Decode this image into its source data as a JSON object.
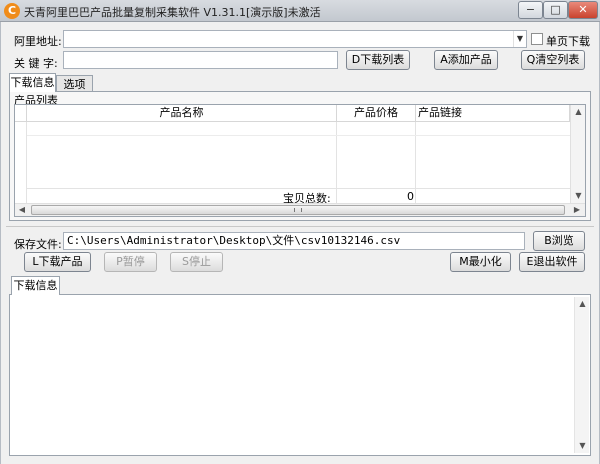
{
  "window": {
    "title": "天青阿里巴巴产品批量复制采集软件 V1.31.1[演示版]未激活",
    "app_icon_glyph": "C",
    "controls": [
      "−",
      "□",
      "✕"
    ]
  },
  "form": {
    "ali_address_label": "阿里地址:",
    "ali_address_value": "",
    "single_page_label": "单页下载",
    "single_page_checked": false,
    "keyword_label": "关 键 字:",
    "keyword_value": ""
  },
  "buttons": {
    "download_list": "D下载列表",
    "add_product": "A添加产品",
    "clear_list": "Q清空列表",
    "browse": "B浏览",
    "download_product": "L下载产品",
    "pause": "P暂停",
    "stop": "S停止",
    "minimize": "M最小化",
    "exit": "E退出软件"
  },
  "top_tabs": [
    "下载信息",
    "选项"
  ],
  "product_list": {
    "group_title": "产品列表",
    "columns": [
      "产品名称",
      "产品价格",
      "产品链接"
    ],
    "total_label": "宝贝总数:",
    "total_value": "0"
  },
  "save": {
    "label": "保存文件:",
    "path": "C:\\Users\\Administrator\\Desktop\\文件\\csv10132146.csv"
  },
  "log": {
    "tab_label": "下载信息",
    "content": ""
  }
}
